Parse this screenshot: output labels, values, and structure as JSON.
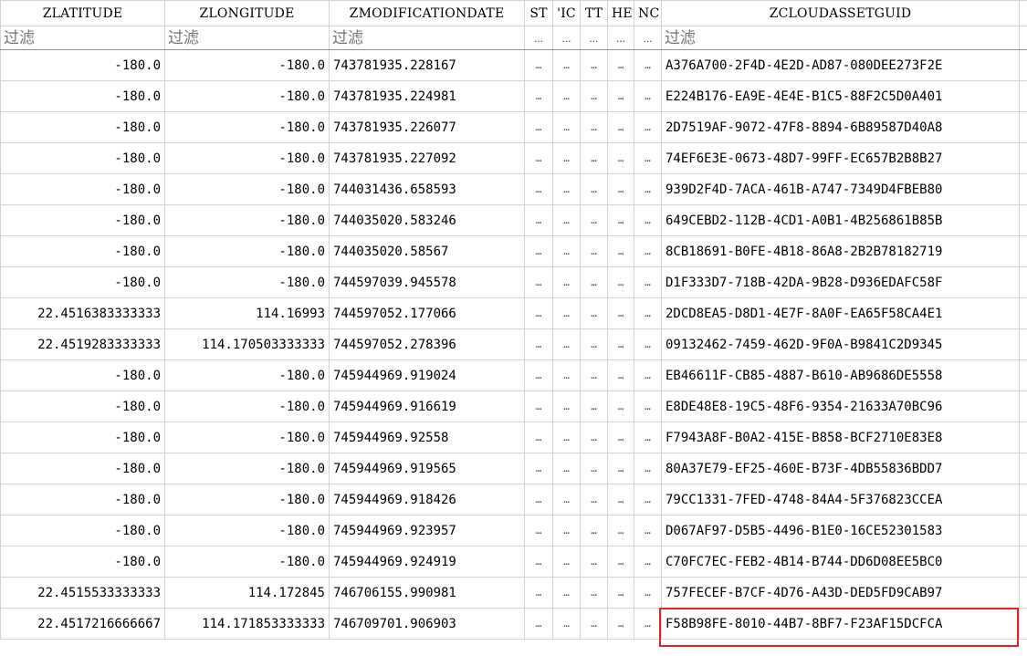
{
  "columns": [
    "ZLATITUDE",
    "ZLONGITUDE",
    "ZMODIFICATIONDATE",
    "ST",
    "'IC",
    "TT",
    "HE",
    "NC",
    "ZCLOUDASSETGUID"
  ],
  "filter_placeholder": "过滤",
  "filter_ellipsis": "...",
  "cell_ellipsis": "…",
  "rows": [
    {
      "lat": "-180.0",
      "lon": "-180.0",
      "date": "743781935.228167",
      "guid": "A376A700-2F4D-4E2D-AD87-080DEE273F2E"
    },
    {
      "lat": "-180.0",
      "lon": "-180.0",
      "date": "743781935.224981",
      "guid": "E224B176-EA9E-4E4E-B1C5-88F2C5D0A401"
    },
    {
      "lat": "-180.0",
      "lon": "-180.0",
      "date": "743781935.226077",
      "guid": "2D7519AF-9072-47F8-8894-6B89587D40A8"
    },
    {
      "lat": "-180.0",
      "lon": "-180.0",
      "date": "743781935.227092",
      "guid": "74EF6E3E-0673-48D7-99FF-EC657B2B8B27"
    },
    {
      "lat": "-180.0",
      "lon": "-180.0",
      "date": "744031436.658593",
      "guid": "939D2F4D-7ACA-461B-A747-7349D4FBEB80"
    },
    {
      "lat": "-180.0",
      "lon": "-180.0",
      "date": "744035020.583246",
      "guid": "649CEBD2-112B-4CD1-A0B1-4B256861B85B"
    },
    {
      "lat": "-180.0",
      "lon": "-180.0",
      "date": "744035020.58567",
      "guid": "8CB18691-B0FE-4B18-86A8-2B2B78182719"
    },
    {
      "lat": "-180.0",
      "lon": "-180.0",
      "date": "744597039.945578",
      "guid": "D1F333D7-718B-42DA-9B28-D936EDAFC58F"
    },
    {
      "lat": "22.4516383333333",
      "lon": "114.16993",
      "date": "744597052.177066",
      "guid": "2DCD8EA5-D8D1-4E7F-8A0F-EA65F58CA4E1"
    },
    {
      "lat": "22.4519283333333",
      "lon": "114.170503333333",
      "date": "744597052.278396",
      "guid": "09132462-7459-462D-9F0A-B9841C2D9345"
    },
    {
      "lat": "-180.0",
      "lon": "-180.0",
      "date": "745944969.919024",
      "guid": "EB46611F-CB85-4887-B610-AB9686DE5558"
    },
    {
      "lat": "-180.0",
      "lon": "-180.0",
      "date": "745944969.916619",
      "guid": "E8DE48E8-19C5-48F6-9354-21633A70BC96"
    },
    {
      "lat": "-180.0",
      "lon": "-180.0",
      "date": "745944969.92558",
      "guid": "F7943A8F-B0A2-415E-B858-BCF2710E83E8"
    },
    {
      "lat": "-180.0",
      "lon": "-180.0",
      "date": "745944969.919565",
      "guid": "80A37E79-EF25-460E-B73F-4DB55836BDD7"
    },
    {
      "lat": "-180.0",
      "lon": "-180.0",
      "date": "745944969.918426",
      "guid": "79CC1331-7FED-4748-84A4-5F376823CCEA"
    },
    {
      "lat": "-180.0",
      "lon": "-180.0",
      "date": "745944969.923957",
      "guid": "D067AF97-D5B5-4496-B1E0-16CE52301583"
    },
    {
      "lat": "-180.0",
      "lon": "-180.0",
      "date": "745944969.924919",
      "guid": "C70FC7EC-FEB2-4B14-B744-DD6D08EE5BC0"
    },
    {
      "lat": "22.4515533333333",
      "lon": "114.172845",
      "date": "746706155.990981",
      "guid": "757FECEF-B7CF-4D76-A43D-DED5FD9CAB97"
    },
    {
      "lat": "22.4517216666667",
      "lon": "114.171853333333",
      "date": "746709701.906903",
      "guid": "F58B98FE-8010-44B7-8BF7-F23AF15DCFCA"
    }
  ],
  "highlight_color": "#e0242a"
}
